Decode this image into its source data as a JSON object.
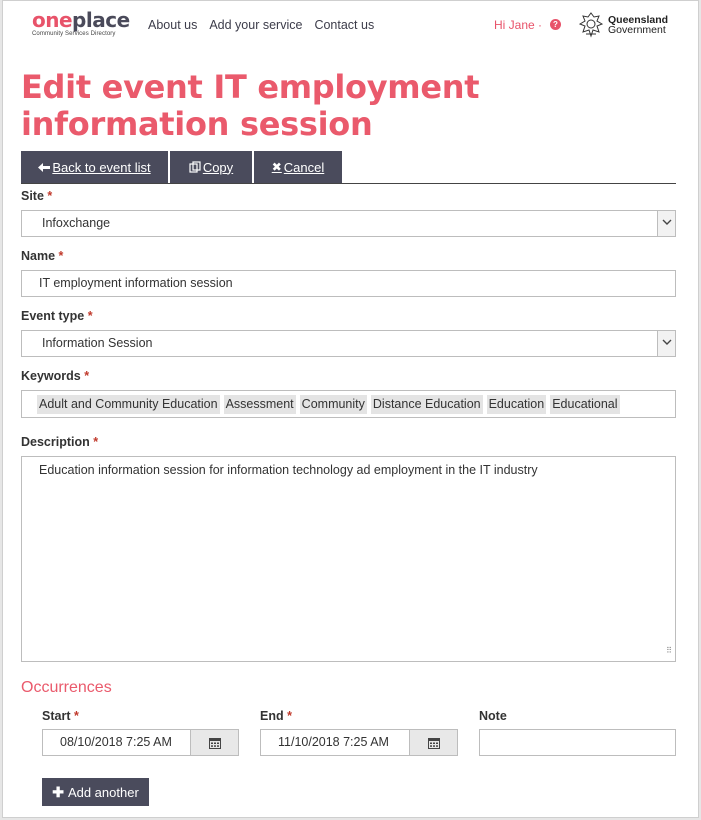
{
  "header": {
    "logo_part1": "one",
    "logo_part2": "place",
    "logo_sub": "Community Services Directory",
    "nav": [
      "About us",
      "Add your service",
      "Contact us"
    ],
    "greeting": "Hi Jane ·",
    "help_icon": "?",
    "gov_line1": "Queensland",
    "gov_line2": "Government"
  },
  "page_title": "Edit event IT employment information session",
  "toolbar": {
    "back_label": "Back to event list",
    "copy_label": "Copy",
    "cancel_label": "Cancel"
  },
  "form": {
    "site_label": "Site",
    "site_value": "Infoxchange",
    "name_label": "Name",
    "name_value": "IT employment information session",
    "event_type_label": "Event type",
    "event_type_value": "Information Session",
    "keywords_label": "Keywords",
    "keywords": [
      "Adult and Community Education",
      "Assessment",
      "Community",
      "Distance Education",
      "Education",
      "Educational"
    ],
    "description_label": "Description",
    "description_value": "Education information session for information technology ad employment in the IT industry",
    "required_mark": "*"
  },
  "occurrences": {
    "heading": "Occurrences",
    "start_label": "Start",
    "end_label": "End",
    "note_label": "Note",
    "start_value": "08/10/2018 7:25 AM",
    "end_value": "11/10/2018 7:25 AM",
    "note_value": "",
    "add_label": "Add another"
  },
  "colors": {
    "accent": "#ea5a6c",
    "button_bg": "#4a4b5c"
  }
}
